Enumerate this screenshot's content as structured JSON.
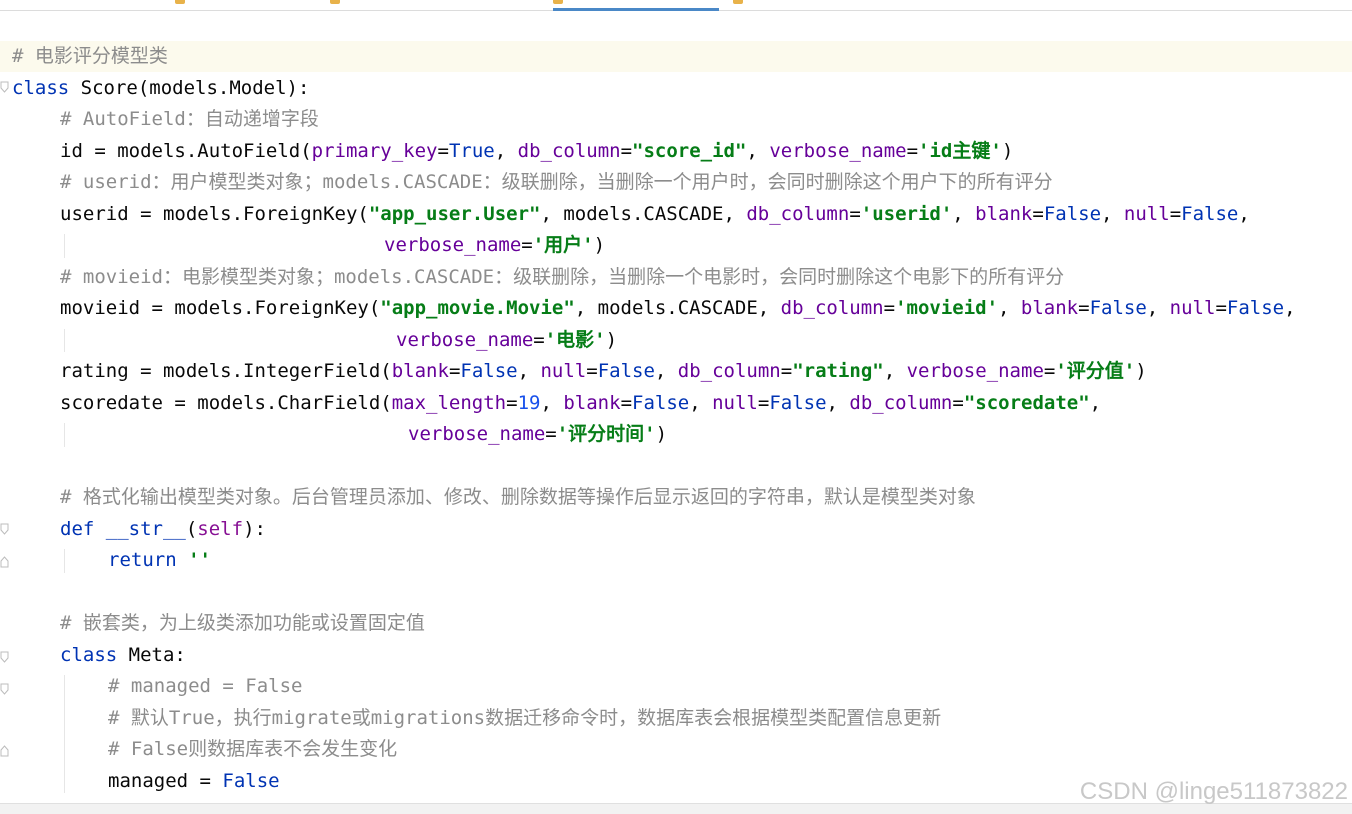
{
  "tabs": [
    {
      "label": "",
      "active": false
    },
    {
      "label": "",
      "active": false
    },
    {
      "label": "",
      "active": true
    },
    {
      "label": "",
      "active": false
    }
  ],
  "code_lines": [
    {
      "n": 1,
      "indent": 0,
      "current": true,
      "tokens": [
        {
          "t": "# 电影评分模型类",
          "c": "cm"
        }
      ]
    },
    {
      "n": 2,
      "indent": 0,
      "tokens": [
        {
          "t": "class ",
          "c": "kw"
        },
        {
          "t": "Score(models.Model):",
          "c": ""
        }
      ]
    },
    {
      "n": 3,
      "indent": 1,
      "tokens": [
        {
          "t": "# AutoField：自动递增字段",
          "c": "cm"
        }
      ]
    },
    {
      "n": 4,
      "indent": 1,
      "tokens": [
        {
          "t": "id = models.AutoField(",
          "c": ""
        },
        {
          "t": "primary_key",
          "c": "kwarg"
        },
        {
          "t": "=",
          "c": ""
        },
        {
          "t": "True",
          "c": "kw"
        },
        {
          "t": ", ",
          "c": ""
        },
        {
          "t": "db_column",
          "c": "kwarg"
        },
        {
          "t": "=",
          "c": ""
        },
        {
          "t": "\"score_id\"",
          "c": "str"
        },
        {
          "t": ", ",
          "c": ""
        },
        {
          "t": "verbose_name",
          "c": "kwarg"
        },
        {
          "t": "=",
          "c": ""
        },
        {
          "t": "'id主键'",
          "c": "str"
        },
        {
          "t": ")",
          "c": ""
        }
      ]
    },
    {
      "n": 5,
      "indent": 1,
      "tokens": [
        {
          "t": "# userid：用户模型类对象；models.CASCADE：级联删除，当删除一个用户时，会同时删除这个用户下的所有评分",
          "c": "cm"
        }
      ]
    },
    {
      "n": 6,
      "indent": 1,
      "tokens": [
        {
          "t": "userid = models.ForeignKey(",
          "c": ""
        },
        {
          "t": "\"app_user.User\"",
          "c": "str"
        },
        {
          "t": ", models.CASCADE, ",
          "c": ""
        },
        {
          "t": "db_column",
          "c": "kwarg"
        },
        {
          "t": "=",
          "c": ""
        },
        {
          "t": "'userid'",
          "c": "str"
        },
        {
          "t": ", ",
          "c": ""
        },
        {
          "t": "blank",
          "c": "kwarg"
        },
        {
          "t": "=",
          "c": ""
        },
        {
          "t": "False",
          "c": "kw"
        },
        {
          "t": ", ",
          "c": ""
        },
        {
          "t": "null",
          "c": "kwarg"
        },
        {
          "t": "=",
          "c": ""
        },
        {
          "t": "False",
          "c": "kw"
        },
        {
          "t": ",",
          "c": ""
        }
      ]
    },
    {
      "n": 7,
      "indent": "cont1",
      "tokens": [
        {
          "t": "verbose_name",
          "c": "kwarg"
        },
        {
          "t": "=",
          "c": ""
        },
        {
          "t": "'用户'",
          "c": "str"
        },
        {
          "t": ")",
          "c": ""
        }
      ]
    },
    {
      "n": 8,
      "indent": 1,
      "tokens": [
        {
          "t": "# movieid：电影模型类对象；models.CASCADE：级联删除，当删除一个电影时，会同时删除这个电影下的所有评分",
          "c": "cm"
        }
      ]
    },
    {
      "n": 9,
      "indent": 1,
      "tokens": [
        {
          "t": "movieid = models.ForeignKey(",
          "c": ""
        },
        {
          "t": "\"app_movie.Movie\"",
          "c": "str"
        },
        {
          "t": ", models.CASCADE, ",
          "c": ""
        },
        {
          "t": "db_column",
          "c": "kwarg"
        },
        {
          "t": "=",
          "c": ""
        },
        {
          "t": "'movieid'",
          "c": "str"
        },
        {
          "t": ", ",
          "c": ""
        },
        {
          "t": "blank",
          "c": "kwarg"
        },
        {
          "t": "=",
          "c": ""
        },
        {
          "t": "False",
          "c": "kw"
        },
        {
          "t": ", ",
          "c": ""
        },
        {
          "t": "null",
          "c": "kwarg"
        },
        {
          "t": "=",
          "c": ""
        },
        {
          "t": "False",
          "c": "kw"
        },
        {
          "t": ",",
          "c": ""
        }
      ]
    },
    {
      "n": 10,
      "indent": "cont2",
      "tokens": [
        {
          "t": "verbose_name",
          "c": "kwarg"
        },
        {
          "t": "=",
          "c": ""
        },
        {
          "t": "'电影'",
          "c": "str"
        },
        {
          "t": ")",
          "c": ""
        }
      ]
    },
    {
      "n": 11,
      "indent": 1,
      "tokens": [
        {
          "t": "rating = models.IntegerField(",
          "c": ""
        },
        {
          "t": "blank",
          "c": "kwarg"
        },
        {
          "t": "=",
          "c": ""
        },
        {
          "t": "False",
          "c": "kw"
        },
        {
          "t": ", ",
          "c": ""
        },
        {
          "t": "null",
          "c": "kwarg"
        },
        {
          "t": "=",
          "c": ""
        },
        {
          "t": "False",
          "c": "kw"
        },
        {
          "t": ", ",
          "c": ""
        },
        {
          "t": "db_column",
          "c": "kwarg"
        },
        {
          "t": "=",
          "c": ""
        },
        {
          "t": "\"rating\"",
          "c": "str"
        },
        {
          "t": ", ",
          "c": ""
        },
        {
          "t": "verbose_name",
          "c": "kwarg"
        },
        {
          "t": "=",
          "c": ""
        },
        {
          "t": "'评分值'",
          "c": "str"
        },
        {
          "t": ")",
          "c": ""
        }
      ]
    },
    {
      "n": 12,
      "indent": 1,
      "tokens": [
        {
          "t": "scoredate = models.CharField(",
          "c": ""
        },
        {
          "t": "max_length",
          "c": "kwarg"
        },
        {
          "t": "=",
          "c": ""
        },
        {
          "t": "19",
          "c": "num"
        },
        {
          "t": ", ",
          "c": ""
        },
        {
          "t": "blank",
          "c": "kwarg"
        },
        {
          "t": "=",
          "c": ""
        },
        {
          "t": "False",
          "c": "kw"
        },
        {
          "t": ", ",
          "c": ""
        },
        {
          "t": "null",
          "c": "kwarg"
        },
        {
          "t": "=",
          "c": ""
        },
        {
          "t": "False",
          "c": "kw"
        },
        {
          "t": ", ",
          "c": ""
        },
        {
          "t": "db_column",
          "c": "kwarg"
        },
        {
          "t": "=",
          "c": ""
        },
        {
          "t": "\"scoredate\"",
          "c": "str"
        },
        {
          "t": ",",
          "c": ""
        }
      ]
    },
    {
      "n": 13,
      "indent": "cont3",
      "tokens": [
        {
          "t": "verbose_name",
          "c": "kwarg"
        },
        {
          "t": "=",
          "c": ""
        },
        {
          "t": "'评分时间'",
          "c": "str"
        },
        {
          "t": ")",
          "c": ""
        }
      ]
    },
    {
      "n": 14,
      "indent": 0,
      "tokens": []
    },
    {
      "n": 15,
      "indent": 1,
      "tokens": [
        {
          "t": "# 格式化输出模型类对象。后台管理员添加、修改、删除数据等操作后显示返回的字符串，默认是模型类对象",
          "c": "cm"
        }
      ]
    },
    {
      "n": 16,
      "indent": 1,
      "tokens": [
        {
          "t": "def ",
          "c": "kw"
        },
        {
          "t": "__str__",
          "c": "df"
        },
        {
          "t": "(",
          "c": ""
        },
        {
          "t": "self",
          "c": "sp"
        },
        {
          "t": "):",
          "c": ""
        }
      ]
    },
    {
      "n": 17,
      "indent": 2,
      "tokens": [
        {
          "t": "return ",
          "c": "kw"
        },
        {
          "t": "''",
          "c": "str"
        }
      ]
    },
    {
      "n": 18,
      "indent": 0,
      "tokens": []
    },
    {
      "n": 19,
      "indent": 1,
      "tokens": [
        {
          "t": "# 嵌套类，为上级类添加功能或设置固定值",
          "c": "cm"
        }
      ]
    },
    {
      "n": 20,
      "indent": 1,
      "tokens": [
        {
          "t": "class ",
          "c": "kw"
        },
        {
          "t": "Meta:",
          "c": ""
        }
      ]
    },
    {
      "n": 21,
      "indent": 2,
      "tokens": [
        {
          "t": "# managed = False",
          "c": "cm"
        }
      ]
    },
    {
      "n": 22,
      "indent": 2,
      "tokens": [
        {
          "t": "# 默认True，执行migrate或migrations数据迁移命令时，数据库表会根据模型类配置信息更新",
          "c": "cm"
        }
      ]
    },
    {
      "n": 23,
      "indent": 2,
      "tokens": [
        {
          "t": "# False则数据库表不会发生变化",
          "c": "cm"
        }
      ]
    },
    {
      "n": 24,
      "indent": 2,
      "tokens": [
        {
          "t": "managed = ",
          "c": ""
        },
        {
          "t": "False",
          "c": "kw"
        }
      ]
    }
  ],
  "watermark": "CSDN @linge511873822",
  "colors": {
    "keyword": "#0033b3",
    "comment": "#8c8c8c",
    "string": "#067d17",
    "kwarg": "#660099",
    "number": "#1750eb",
    "current_line": "#fcfaed"
  }
}
